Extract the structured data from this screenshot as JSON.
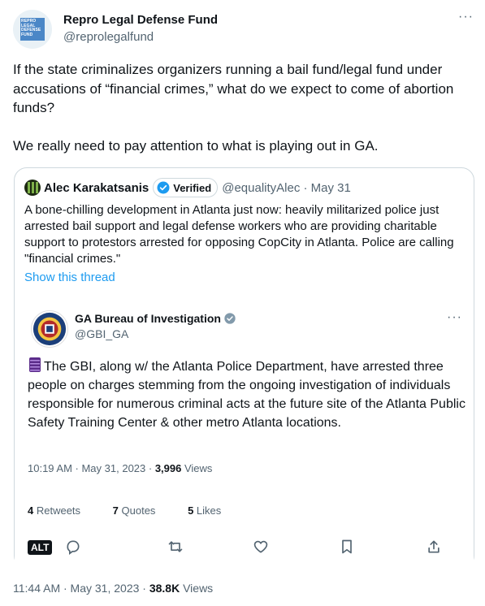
{
  "author": {
    "name": "Repro Legal Defense Fund",
    "handle": "@reprolegalfund",
    "avatar_text": "REPRO LEGAL DEFENSE FUND",
    "more_label": "···"
  },
  "tweet": {
    "paragraphs": [
      "If the state criminalizes organizers running a bail fund/legal fund under accusations of “financial crimes,” what do we expect to come of abortion funds?",
      "We really need to pay attention to what is playing out in GA."
    ],
    "timestamp": "11:44 AM · May 31, 2023 · ",
    "views_count": "38.8K",
    "views_label": " Views"
  },
  "quote": {
    "name": "Alec Karakatsanis",
    "verified_label": "Verified",
    "handle_date": "@equalityAlec · May 31",
    "text": "A bone-chilling development in Atlanta just now: heavily militarized police just arrested bail support and legal defense workers who are providing charitable support to protestors arrested for opposing CopCity in Atlanta.  Police are calling \"financial crimes.\"",
    "show_thread": "Show this thread",
    "embedded": {
      "name": "GA Bureau of Investigation",
      "handle": "@GBI_GA",
      "text": "The GBI, along w/ the Atlanta Police Department, have arrested three people on charges stemming from the ongoing investigation of individuals responsible for numerous criminal acts at the future site of the Atlanta Public Safety Training Center & other metro Atlanta locations.",
      "time_prefix": "10:19 AM · May 31, 2023 · ",
      "views_count": "3,996",
      "views_label": " Views",
      "retweets_count": "4",
      "retweets_label": " Retweets",
      "quotes_count": "7",
      "quotes_label": " Quotes",
      "likes_count": "5",
      "likes_label": " Likes",
      "alt_label": "ALT",
      "more_label": "···"
    }
  },
  "colors": {
    "link": "#1d9bf0",
    "secondary_text": "#536471",
    "border": "#cfd9de",
    "verified_badge": "#1d9bf0",
    "gbi_badge": "#829aab"
  }
}
